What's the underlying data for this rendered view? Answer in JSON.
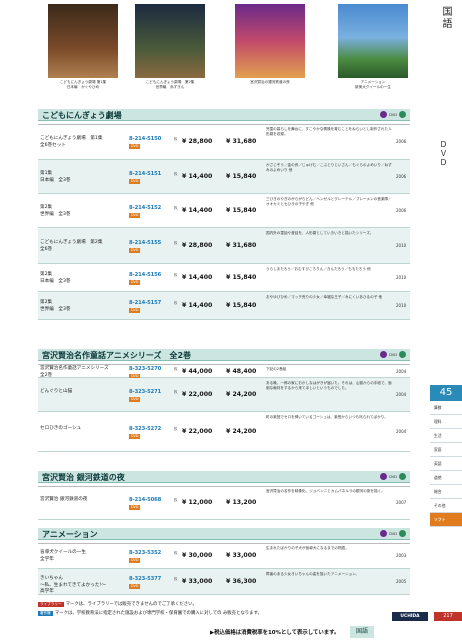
{
  "side": {
    "tab_label": "国語",
    "dvd_label": "ＤＶＤ",
    "page_number": "45"
  },
  "thumbs": [
    {
      "caption": "こどもにんぎょう劇場 第1集\n日本編　かぐやひめ"
    },
    {
      "caption": "こどもにんぎょう劇場　第2集\n世界編　赤ずきん"
    },
    {
      "caption": "宮沢賢治の銀河鉄道の夜"
    },
    {
      "caption": "アニメーション\n新美大クイールの一生"
    }
  ],
  "sections": [
    {
      "title": "こどもにんぎょう劇場",
      "rows": [
        {
          "title": "こどもにんぎょう劇場　第1集\n全6巻セット",
          "code": "8-214-5150",
          "tag": "DVD",
          "disc": "枚",
          "price": "¥ 28,800",
          "price_tax": "¥ 31,680",
          "desc": "児童の暮らしを舞台に、すこやかな情操を育むことをねらいとし制作された人形劇を収録。",
          "year": "2006"
        },
        {
          "title": "第1集\n日本編　全3巻",
          "code": "8-214-5151",
          "tag": "DVD",
          "disc": "枚",
          "price": "¥ 14,400",
          "price_tax": "¥ 15,840",
          "desc": "かさじぞう／金の斧／じゅげむ／こぶとりじいさん／もぐらのよめいり／ねずみのよめいり 他",
          "year": "2006"
        },
        {
          "title": "第2集\n世界編　全3巻",
          "code": "8-214-5152",
          "tag": "DVD",
          "disc": "枚",
          "price": "¥ 14,400",
          "price_tax": "¥ 15,840",
          "desc": "三びきのやぎのがらがらどん／ヘンゼルとグレーテル／ブレーメンの音楽隊／オオカミと七ひきの子やぎ 他",
          "year": "2006"
        },
        {
          "title": "こどもにんぎょう劇場　第2集\n全6巻",
          "code": "8-214-5155",
          "tag": "DVD",
          "disc": "枚",
          "price": "¥ 28,800",
          "price_tax": "¥ 31,680",
          "desc": "国内外の童話や昔話を、人形劇としていきいきと描いたシリーズ。",
          "year": "2010"
        },
        {
          "title": "第2集\n日本編　全3巻",
          "code": "8-214-5156",
          "tag": "DVD",
          "disc": "枚",
          "price": "¥ 14,400",
          "price_tax": "¥ 15,840",
          "desc": "うらしまたろう／おむすびころりん／きんたろう／ももたろう 他",
          "year": "2010"
        },
        {
          "title": "第2集\n世界編　全3巻",
          "code": "8-214-5157",
          "tag": "DVD",
          "disc": "枚",
          "price": "¥ 14,400",
          "price_tax": "¥ 15,840",
          "desc": "おやゆびひめ／マッチ売りの少女／幸福な王子／みにくいあひるの子 他",
          "year": "2010"
        }
      ]
    },
    {
      "title": "宮沢賢治名作童話アニメシリーズ　全2巻",
      "rows": [
        {
          "title": "宮沢賢治名作童話アニメシリーズ\n全2巻",
          "code": "8-323-5270",
          "tag": "DVD",
          "disc": "枚",
          "price": "¥ 44,000",
          "price_tax": "¥ 48,400",
          "desc": "下記の2巻組",
          "year": "2004"
        },
        {
          "title": "どんぐりと山猫",
          "code": "8-323-5271",
          "tag": "DVD",
          "disc": "枚",
          "price": "¥ 22,000",
          "price_tax": "¥ 24,200",
          "desc": "ある晩、一郎の家におかしなはがきが届いた。それは、山猫からの手紙で、面倒な裁判をするから来てほしいというものでした。",
          "year": "2004"
        },
        {
          "title": "セロひきのゴーシュ",
          "code": "8-323-5272",
          "tag": "DVD",
          "disc": "枚",
          "price": "¥ 22,000",
          "price_tax": "¥ 24,200",
          "desc": "町の楽団でセロを弾いているゴーシュは、楽長からいつも叱られてばかり。",
          "year": "2004"
        }
      ]
    },
    {
      "title": "宮沢賢治 銀河鉄道の夜",
      "rows": [
        {
          "title": "宮沢賢治 銀河鉄道の夜",
          "code": "8-214-5068",
          "tag": "DVD",
          "disc": "枚",
          "price": "¥ 12,000",
          "price_tax": "¥ 13,200",
          "desc": "宮沢賢治の名作を映像化。ジョバンニとカムパネルラの銀河の旅を描く。",
          "year": "2007"
        }
      ]
    },
    {
      "title": "アニメーション",
      "rows": [
        {
          "title": "盲導犬クイールの一生\n全学年",
          "code": "8-323-5352",
          "tag": "DVD",
          "disc": "枚",
          "price": "¥ 30,000",
          "price_tax": "¥ 33,000",
          "desc": "生まれたばかりの子犬が盲導犬になるまでの物語。",
          "year": "2003"
        },
        {
          "title": "きいちゃん\n～私、生まれてきてよかった!～\n高学年",
          "code": "8-323-5377",
          "tag": "DVD",
          "disc": "枚",
          "price": "¥ 33,000",
          "price_tax": "¥ 36,300",
          "desc": "障害のある少女きいちゃんの姿を描いたアニメーション。",
          "year": "2005"
        }
      ]
    }
  ],
  "right_tabs": [
    "算数",
    "理科",
    "生活",
    "家庭",
    "英語",
    "道徳",
    "総合",
    "その他",
    "ソフト"
  ],
  "footer": {
    "note1_badge": "ライブラリー",
    "note1": "マークは、ライブラリーでは販売できませんのでご了承ください。",
    "note2_badge": "著作権",
    "note2": "マークは、学校教育法に指定された施設および専門学校・保育園での購入に対しての み販売となります。",
    "tax_note": "▶税込価格は消費税率を10%として表示しています。",
    "bottom_label": "国語",
    "page_number": "217",
    "brand": "UCHIDA"
  }
}
